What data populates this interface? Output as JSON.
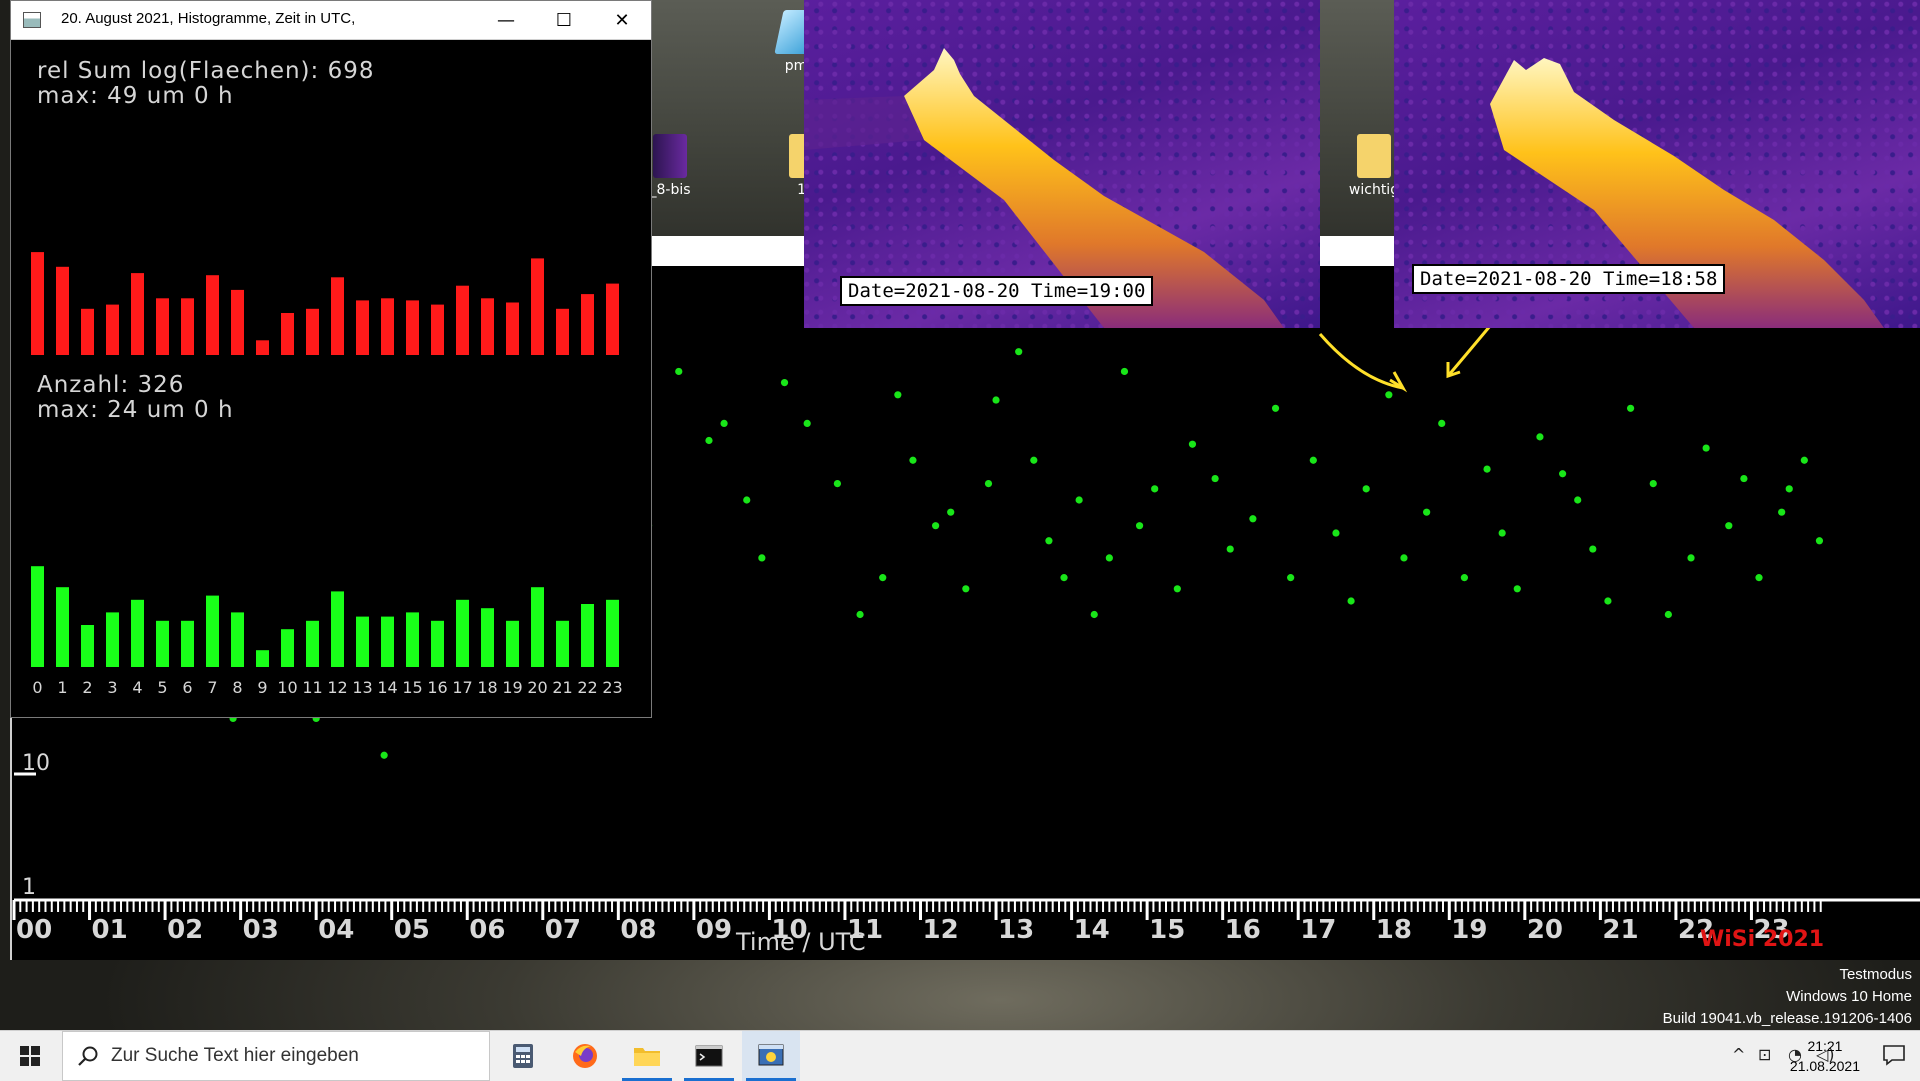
{
  "histogram_window": {
    "title": "20. August 2021, Histogramme, Zeit in UTC,",
    "area_line1": "rel Sum log(Flaechen): 698",
    "area_line2": "max: 49 um 0 h",
    "count_line1": "Anzahl: 326",
    "count_line2": "max: 24 um 0 h",
    "minimize_label": "—",
    "maximize_label": "☐",
    "close_label": "✕"
  },
  "spectrogram_left": {
    "stamp": "Date=2021-08-20 Time=19:00"
  },
  "spectrogram_right": {
    "stamp": "Date=2021-08-20 Time=18:58"
  },
  "desktop_icons": [
    {
      "label": "pm",
      "icon": "app-shortcut-icon"
    },
    {
      "label": "_8-bis",
      "icon": "book-icon"
    },
    {
      "label": "17",
      "icon": "folder-icon"
    },
    {
      "label": "wichtig",
      "icon": "folder-icon"
    }
  ],
  "plot": {
    "axis_title": "Time / UTC",
    "signature": "WiSi 2021",
    "y_tick_labels": [
      "10",
      "1"
    ],
    "hour_labels": [
      "00",
      "01",
      "02",
      "03",
      "04",
      "05",
      "06",
      "07",
      "08",
      "09",
      "10",
      "11",
      "12",
      "13",
      "14",
      "15",
      "16",
      "17",
      "18",
      "19",
      "20",
      "21",
      "22",
      "23"
    ]
  },
  "watermark": {
    "line1": "Testmodus",
    "line2": "Windows 10 Home",
    "line3": "Build 19041.vb_release.191206-1406"
  },
  "taskbar": {
    "search_placeholder": "Zur Suche Text hier eingeben",
    "apps": [
      "calculator-icon",
      "firefox-icon",
      "file-explorer-icon",
      "terminal-icon",
      "python-icon"
    ],
    "time": "21:21",
    "date": "21.08.2021"
  },
  "colors": {
    "area_bar": "#ff1a1a",
    "count_bar": "#19ff19",
    "meteor_dot": "#19e619",
    "highlight_dot": "#ffee33",
    "signature": "#e01414"
  },
  "chart_data": [
    {
      "type": "bar",
      "title": "rel Sum log(Flaechen): 698",
      "categories": [
        "0",
        "1",
        "2",
        "3",
        "4",
        "5",
        "6",
        "7",
        "8",
        "9",
        "10",
        "11",
        "12",
        "13",
        "14",
        "15",
        "16",
        "17",
        "18",
        "19",
        "20",
        "21",
        "22",
        "23"
      ],
      "series": [
        {
          "name": "rel Sum log(Flaechen)",
          "values": [
            49,
            42,
            22,
            24,
            39,
            27,
            27,
            38,
            31,
            7,
            20,
            22,
            37,
            26,
            27,
            26,
            24,
            33,
            27,
            25,
            46,
            22,
            29,
            34
          ]
        }
      ]
    },
    {
      "type": "bar",
      "title": "Anzahl: 326",
      "categories": [
        "0",
        "1",
        "2",
        "3",
        "4",
        "5",
        "6",
        "7",
        "8",
        "9",
        "10",
        "11",
        "12",
        "13",
        "14",
        "15",
        "16",
        "17",
        "18",
        "19",
        "20",
        "21",
        "22",
        "23"
      ],
      "series": [
        {
          "name": "Anzahl",
          "values": [
            24,
            19,
            10,
            13,
            16,
            11,
            11,
            17,
            13,
            4,
            9,
            11,
            18,
            12,
            12,
            13,
            11,
            16,
            14,
            11,
            19,
            11,
            15,
            16
          ]
        }
      ]
    },
    {
      "type": "scatter",
      "xlabel": "Time / UTC",
      "xlim": [
        0,
        24
      ],
      "ylim": [
        1,
        100
      ],
      "yscale": "log",
      "series": [
        {
          "x": [
            0.2,
            0.4,
            0.7,
            0.9,
            1.2,
            1.5,
            1.7,
            1.9,
            2.4,
            2.9,
            3.3,
            3.5,
            3.7,
            4.0,
            4.9,
            6.9,
            7.3,
            7.8,
            8.1,
            8.4,
            8.8,
            9.2,
            9.4,
            9.7,
            9.9,
            10.2,
            10.5,
            10.9,
            11.2,
            11.5,
            11.7,
            11.9,
            12.2,
            12.4,
            12.6,
            12.9,
            13.0,
            13.3,
            13.5,
            13.7,
            13.9,
            14.1,
            14.3,
            14.5,
            14.7,
            14.9,
            15.1,
            15.4,
            15.6,
            15.9,
            16.1,
            16.4,
            16.7,
            16.9,
            17.2,
            17.5,
            17.7,
            17.9,
            18.2,
            18.4,
            18.7,
            18.9,
            19.2,
            19.5,
            19.7,
            19.9,
            20.2,
            20.5,
            20.7,
            20.9,
            21.1,
            21.4,
            21.7,
            21.9,
            22.2,
            22.4,
            22.7,
            22.9,
            23.1,
            23.4,
            23.5,
            23.7,
            23.9
          ],
          "y": [
            11,
            12,
            8,
            5,
            13,
            14,
            15,
            6,
            12,
            4,
            5,
            14,
            10,
            4,
            3,
            13,
            30,
            20,
            45,
            18,
            60,
            35,
            40,
            22,
            14,
            55,
            40,
            25,
            9,
            12,
            50,
            30,
            18,
            20,
            11,
            25,
            48,
            70,
            30,
            16,
            12,
            22,
            9,
            14,
            60,
            18,
            24,
            11,
            34,
            26,
            15,
            19,
            45,
            12,
            30,
            17,
            10,
            24,
            50,
            14,
            20,
            40,
            12,
            28,
            17,
            11,
            36,
            27,
            22,
            15,
            10,
            45,
            25,
            9,
            14,
            33,
            18,
            26,
            12,
            20,
            24,
            30,
            16
          ],
          "name": ""
        }
      ]
    }
  ]
}
